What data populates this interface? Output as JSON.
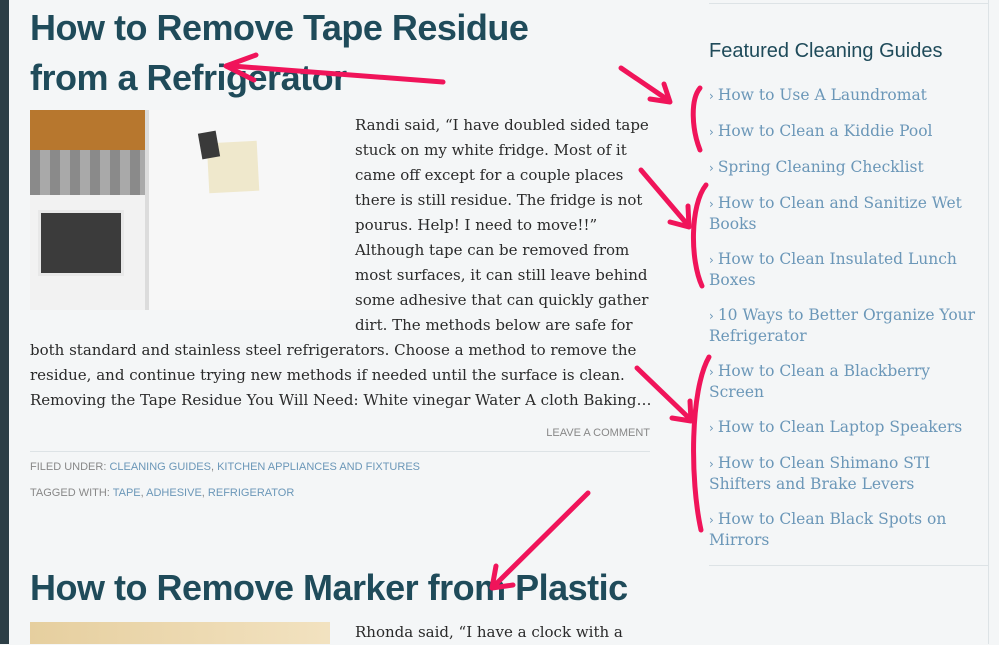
{
  "post1": {
    "title": "How to Remove Tape Residue from a Refrigerator",
    "excerpt_top": "Randi said, “I have doubled sided tape stuck on my white fridge. Most of it came off except for a couple places there is still residue. The fridge is not pourus. Help! I need to move!!” Although tape can be removed from most surfaces, it can still leave behind some adhesive that can quickly gather dirt. The methods below are safe for",
    "excerpt_bottom": "both standard and stainless steel refrigerators. Choose a method to remove the residue, and continue trying new methods if needed until the surface is clean. Removing the Tape Residue You Will Need: White vinegar Water A cloth Baking…",
    "leave_comment": "LEAVE A COMMENT",
    "filed_under_label": "FILED UNDER:",
    "categories": [
      "CLEANING GUIDES",
      "KITCHEN APPLIANCES AND FIXTURES"
    ],
    "tagged_with_label": "TAGGED WITH:",
    "tags": [
      "TAPE",
      "ADHESIVE",
      "REFRIGERATOR"
    ]
  },
  "post2": {
    "title": "How to Remove Marker from Plastic",
    "excerpt": "Rhonda said, “I have a clock with a"
  },
  "sidebar": {
    "widget_title": "Featured Cleaning Guides",
    "items": [
      "How to Use A Laundromat",
      "How to Clean a Kiddie Pool",
      "Spring Cleaning Checklist",
      "How to Clean and Sanitize Wet Books",
      "How to Clean Insulated Lunch Boxes",
      "10 Ways to Better Organize Your Refrigerator",
      "How to Clean a Blackberry Screen",
      "How to Clean Laptop Speakers",
      "How to Clean Shimano STI Shifters and Brake Levers",
      "How to Clean Black Spots on Mirrors"
    ]
  },
  "colors": {
    "title": "#1f4b5a",
    "link": "#6b97b8",
    "annotation": "#f0145a",
    "background": "#f4f6f7"
  }
}
